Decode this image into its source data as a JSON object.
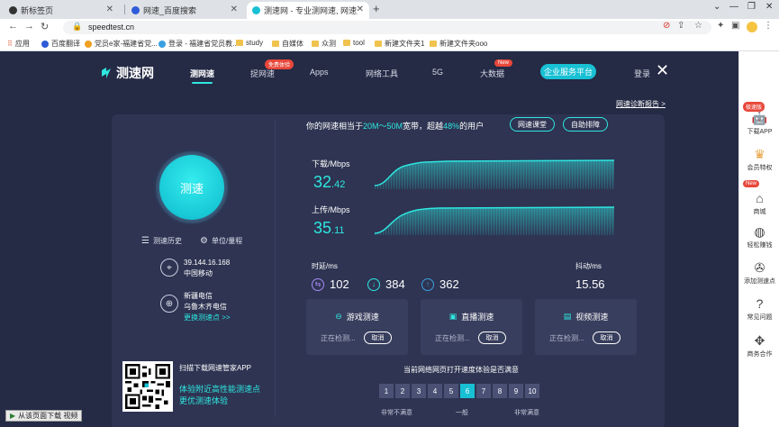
{
  "browser": {
    "tabs": [
      {
        "title": "新标签页",
        "active": false
      },
      {
        "title": "网速_百度搜索",
        "active": false
      },
      {
        "title": "测速网 - 专业测网速, 网速测试, ...",
        "active": true
      }
    ],
    "new_tab": "+",
    "url": "speedtest.cn",
    "bookmarks": [
      "应用",
      "百度翻译",
      "党员e家-福建省党...",
      "登录 - 福建省党员教...",
      "study",
      "自媒体",
      "众测",
      "tool",
      "新建文件夹1",
      "新建文件夹ooo"
    ]
  },
  "site": {
    "logo": "测速网",
    "nav": [
      {
        "label": "测网速",
        "active": true
      },
      {
        "label": "捉网速",
        "badge": "免费体验"
      },
      {
        "label": "Apps"
      },
      {
        "label": "网络工具"
      },
      {
        "label": "5G"
      },
      {
        "label": "大数据",
        "badge": "New"
      }
    ],
    "enterprise_button": "企业服务平台",
    "login": "登录",
    "diag_report": "网速诊断报告 >"
  },
  "left_panel": {
    "test_button": "测速",
    "history": "测速历史",
    "unit": "单位/量程",
    "ip": "39.144.16.168",
    "isp": "中国移动",
    "server_name": "新疆电信",
    "server_city": "乌鲁木齐电信",
    "change_server": "更换测速点 >>",
    "app_title": "扫描下载网速管家APP",
    "app_line1": "体验附近高性能测速点",
    "app_line2": "更优测速体验"
  },
  "result": {
    "prefix": "你的网速相当于",
    "bandwidth": "20M～50M",
    "mid": "宽带，超越",
    "percent": "48%",
    "suffix": "的用户",
    "btn_course": "网速课堂",
    "btn_sort": "自助排障",
    "download_label": "下载/Mbps",
    "download_int": "32",
    "download_dec": ".42",
    "upload_label": "上传/Mbps",
    "upload_int": "35",
    "upload_dec": ".11",
    "latency_label": "时延/ms",
    "jitter_label": "抖动/ms",
    "latency_idle": "102",
    "latency_down": "384",
    "latency_up": "362",
    "jitter": "15.56"
  },
  "subtests": [
    {
      "title": "游戏测速",
      "status": "正在检测...",
      "cancel": "取消"
    },
    {
      "title": "直播测速",
      "status": "正在检测...",
      "cancel": "取消"
    },
    {
      "title": "视频测速",
      "status": "正在检测...",
      "cancel": "取消"
    }
  ],
  "survey": {
    "question": "当前网络网页打开速度体验是否满意",
    "numbers": [
      "1",
      "2",
      "3",
      "4",
      "5",
      "6",
      "7",
      "8",
      "9",
      "10"
    ],
    "selected": 6,
    "low": "非常不满意",
    "mid": "一般",
    "high": "非常满意"
  },
  "right_bar": [
    {
      "badge": "极速版",
      "label": "下载APP"
    },
    {
      "label": "会员特权"
    },
    {
      "badge": "New",
      "label": "商城"
    },
    {
      "label": "轻松赚钱"
    },
    {
      "label": "添加测速点"
    },
    {
      "label": "常见问题"
    },
    {
      "label": "商务合作"
    }
  ],
  "bottom_tip": "从该页面下载 视频",
  "colors": {
    "accent": "#2ee7e0",
    "bg": "#252a45",
    "card": "#2e3452",
    "badge": "#e8473a"
  }
}
